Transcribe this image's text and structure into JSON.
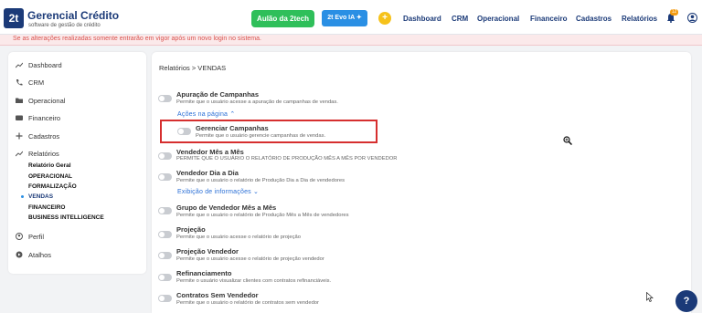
{
  "brand": {
    "logo": "2t",
    "title": "Gerencial Crédito",
    "subtitle": "software de gestão de crédito"
  },
  "header": {
    "aulao_button": "Aulão da 2tech",
    "ia_button": "2t Evo IA",
    "nav": [
      "Dashboard",
      "CRM",
      "Operacional",
      "Financeiro",
      "Cadastros",
      "Relatórios"
    ],
    "notification_count": "12"
  },
  "alert": "Se as alterações realizadas somente entrarão em vigor após um novo login no sistema.",
  "sidebar": {
    "items": [
      {
        "label": "Dashboard",
        "icon": "chart-line-icon"
      },
      {
        "label": "CRM",
        "icon": "phone-icon"
      },
      {
        "label": "Operacional",
        "icon": "folder-icon"
      },
      {
        "label": "Financeiro",
        "icon": "wallet-icon"
      },
      {
        "label": "Cadastros",
        "icon": "plus-icon"
      },
      {
        "label": "Relatórios",
        "icon": "chart-line-icon"
      }
    ],
    "report_subitems": [
      "Relatório Geral",
      "OPERACIONAL",
      "FORMALIZAÇÃO",
      "VENDAS",
      "FINANCEIRO",
      "BUSINESS INTELLIGENCE"
    ],
    "active_subitem": "VENDAS",
    "bottom_items": [
      {
        "label": "Perfil",
        "icon": "user-icon"
      },
      {
        "label": "Atalhos",
        "icon": "shortcut-icon"
      }
    ]
  },
  "main": {
    "breadcrumb": "Relatórios > VENDAS",
    "permissions": [
      {
        "title": "Apuração de Campanhas",
        "desc": "Permite que o usuário acesse a apuração de campanhas de vendas."
      },
      {
        "title": "Gerenciar Campanhas",
        "desc": "Permite que o usuário gerencie campanhas de vendas."
      },
      {
        "title": "Vendedor Mês a Mês",
        "desc": "PERMITE QUE O USUÁRIO O RELATÓRIO DE PRODUÇÃO MÊS A MÊS POR VENDEDOR"
      },
      {
        "title": "Vendedor Dia a Dia",
        "desc": "Permite que o usuário o relatório de Produção Dia a Dia de vendedores"
      },
      {
        "title": "Grupo de Vendedor Mês a Mês",
        "desc": "Permite que o usuário o relatório de Produção Mês a Mês de vendedores"
      },
      {
        "title": "Projeção",
        "desc": "Permite que o usuário acesse o relatório de projeção"
      },
      {
        "title": "Projeção Vendedor",
        "desc": "Permite que o usuário acesse o relatório de projeção vendedor"
      },
      {
        "title": "Refinanciamento",
        "desc": "Permite o usuário visualizar clientes com contratos refinanciáveis."
      },
      {
        "title": "Contratos Sem Vendedor",
        "desc": "Permite que o usuário o relatório de contratos sem vendedor"
      }
    ],
    "actions_link": "Ações na página",
    "info_link": "Exibição de informações"
  },
  "help_label": "?"
}
